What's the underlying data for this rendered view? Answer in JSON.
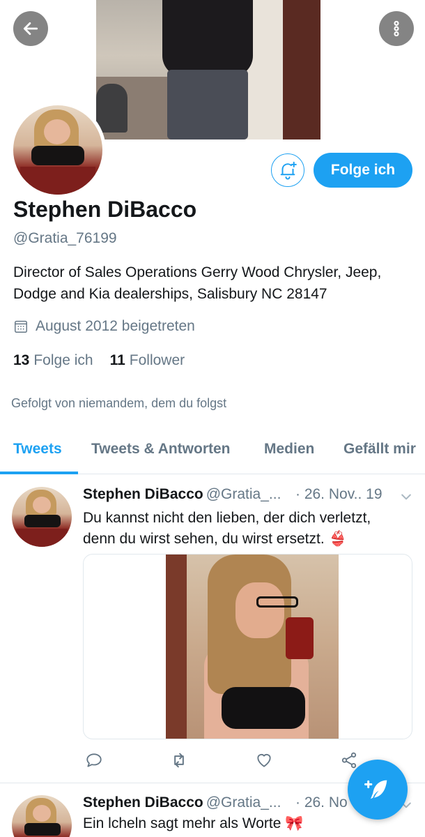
{
  "header": {
    "back_icon": "arrow-left-icon",
    "more_icon": "more-vertical-icon"
  },
  "profile": {
    "name": "Stephen DiBacco",
    "handle": "@Gratia_76199",
    "bio": "Director of Sales Operations Gerry Wood Chrysler, Jeep, Dodge and Kia dealerships, Salisbury NC 28147",
    "joined": "August 2012 beigetreten",
    "following_count": "13",
    "following_label": "Folge ich",
    "followers_count": "11",
    "followers_label": "Follower",
    "followed_by": "Gefolgt von niemandem, dem du folgst",
    "follow_button": "Folge ich"
  },
  "tabs": [
    {
      "label": "Tweets",
      "active": true
    },
    {
      "label": "Tweets & Antworten",
      "active": false
    },
    {
      "label": "Medien",
      "active": false
    },
    {
      "label": "Gefällt mir",
      "active": false
    }
  ],
  "tweets": [
    {
      "name": "Stephen DiBacco",
      "handle": "@Gratia_...",
      "date": "· 26. Nov.. 19",
      "text": "Du kannst nicht den lieben, der dich verletzt, denn du wirst sehen, du wirst ersetzt. 👙"
    },
    {
      "name": "Stephen DiBacco",
      "handle": "@Gratia_...",
      "date": "· 26. No",
      "text": "Ein lcheln sagt mehr als Worte 🎀"
    }
  ],
  "colors": {
    "accent": "#1da1f2",
    "secondary_text": "#657786",
    "primary_text": "#14171a"
  }
}
